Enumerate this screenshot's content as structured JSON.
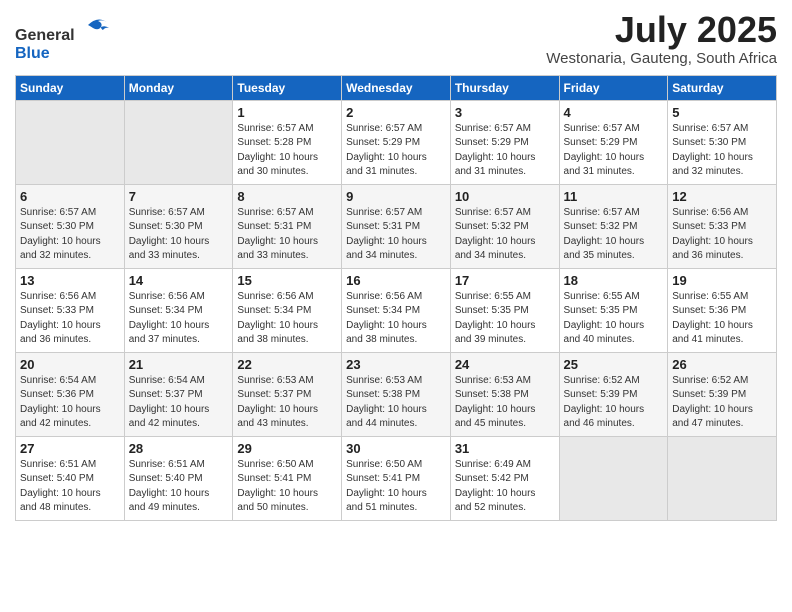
{
  "header": {
    "logo": {
      "general": "General",
      "blue": "Blue"
    },
    "title": "July 2025",
    "subtitle": "Westonaria, Gauteng, South Africa"
  },
  "calendar": {
    "weekdays": [
      "Sunday",
      "Monday",
      "Tuesday",
      "Wednesday",
      "Thursday",
      "Friday",
      "Saturday"
    ],
    "weeks": [
      [
        {
          "day": "",
          "info": ""
        },
        {
          "day": "",
          "info": ""
        },
        {
          "day": "1",
          "info": "Sunrise: 6:57 AM\nSunset: 5:28 PM\nDaylight: 10 hours\nand 30 minutes."
        },
        {
          "day": "2",
          "info": "Sunrise: 6:57 AM\nSunset: 5:29 PM\nDaylight: 10 hours\nand 31 minutes."
        },
        {
          "day": "3",
          "info": "Sunrise: 6:57 AM\nSunset: 5:29 PM\nDaylight: 10 hours\nand 31 minutes."
        },
        {
          "day": "4",
          "info": "Sunrise: 6:57 AM\nSunset: 5:29 PM\nDaylight: 10 hours\nand 31 minutes."
        },
        {
          "day": "5",
          "info": "Sunrise: 6:57 AM\nSunset: 5:30 PM\nDaylight: 10 hours\nand 32 minutes."
        }
      ],
      [
        {
          "day": "6",
          "info": "Sunrise: 6:57 AM\nSunset: 5:30 PM\nDaylight: 10 hours\nand 32 minutes."
        },
        {
          "day": "7",
          "info": "Sunrise: 6:57 AM\nSunset: 5:30 PM\nDaylight: 10 hours\nand 33 minutes."
        },
        {
          "day": "8",
          "info": "Sunrise: 6:57 AM\nSunset: 5:31 PM\nDaylight: 10 hours\nand 33 minutes."
        },
        {
          "day": "9",
          "info": "Sunrise: 6:57 AM\nSunset: 5:31 PM\nDaylight: 10 hours\nand 34 minutes."
        },
        {
          "day": "10",
          "info": "Sunrise: 6:57 AM\nSunset: 5:32 PM\nDaylight: 10 hours\nand 34 minutes."
        },
        {
          "day": "11",
          "info": "Sunrise: 6:57 AM\nSunset: 5:32 PM\nDaylight: 10 hours\nand 35 minutes."
        },
        {
          "day": "12",
          "info": "Sunrise: 6:56 AM\nSunset: 5:33 PM\nDaylight: 10 hours\nand 36 minutes."
        }
      ],
      [
        {
          "day": "13",
          "info": "Sunrise: 6:56 AM\nSunset: 5:33 PM\nDaylight: 10 hours\nand 36 minutes."
        },
        {
          "day": "14",
          "info": "Sunrise: 6:56 AM\nSunset: 5:34 PM\nDaylight: 10 hours\nand 37 minutes."
        },
        {
          "day": "15",
          "info": "Sunrise: 6:56 AM\nSunset: 5:34 PM\nDaylight: 10 hours\nand 38 minutes."
        },
        {
          "day": "16",
          "info": "Sunrise: 6:56 AM\nSunset: 5:34 PM\nDaylight: 10 hours\nand 38 minutes."
        },
        {
          "day": "17",
          "info": "Sunrise: 6:55 AM\nSunset: 5:35 PM\nDaylight: 10 hours\nand 39 minutes."
        },
        {
          "day": "18",
          "info": "Sunrise: 6:55 AM\nSunset: 5:35 PM\nDaylight: 10 hours\nand 40 minutes."
        },
        {
          "day": "19",
          "info": "Sunrise: 6:55 AM\nSunset: 5:36 PM\nDaylight: 10 hours\nand 41 minutes."
        }
      ],
      [
        {
          "day": "20",
          "info": "Sunrise: 6:54 AM\nSunset: 5:36 PM\nDaylight: 10 hours\nand 42 minutes."
        },
        {
          "day": "21",
          "info": "Sunrise: 6:54 AM\nSunset: 5:37 PM\nDaylight: 10 hours\nand 42 minutes."
        },
        {
          "day": "22",
          "info": "Sunrise: 6:53 AM\nSunset: 5:37 PM\nDaylight: 10 hours\nand 43 minutes."
        },
        {
          "day": "23",
          "info": "Sunrise: 6:53 AM\nSunset: 5:38 PM\nDaylight: 10 hours\nand 44 minutes."
        },
        {
          "day": "24",
          "info": "Sunrise: 6:53 AM\nSunset: 5:38 PM\nDaylight: 10 hours\nand 45 minutes."
        },
        {
          "day": "25",
          "info": "Sunrise: 6:52 AM\nSunset: 5:39 PM\nDaylight: 10 hours\nand 46 minutes."
        },
        {
          "day": "26",
          "info": "Sunrise: 6:52 AM\nSunset: 5:39 PM\nDaylight: 10 hours\nand 47 minutes."
        }
      ],
      [
        {
          "day": "27",
          "info": "Sunrise: 6:51 AM\nSunset: 5:40 PM\nDaylight: 10 hours\nand 48 minutes."
        },
        {
          "day": "28",
          "info": "Sunrise: 6:51 AM\nSunset: 5:40 PM\nDaylight: 10 hours\nand 49 minutes."
        },
        {
          "day": "29",
          "info": "Sunrise: 6:50 AM\nSunset: 5:41 PM\nDaylight: 10 hours\nand 50 minutes."
        },
        {
          "day": "30",
          "info": "Sunrise: 6:50 AM\nSunset: 5:41 PM\nDaylight: 10 hours\nand 51 minutes."
        },
        {
          "day": "31",
          "info": "Sunrise: 6:49 AM\nSunset: 5:42 PM\nDaylight: 10 hours\nand 52 minutes."
        },
        {
          "day": "",
          "info": ""
        },
        {
          "day": "",
          "info": ""
        }
      ]
    ]
  }
}
